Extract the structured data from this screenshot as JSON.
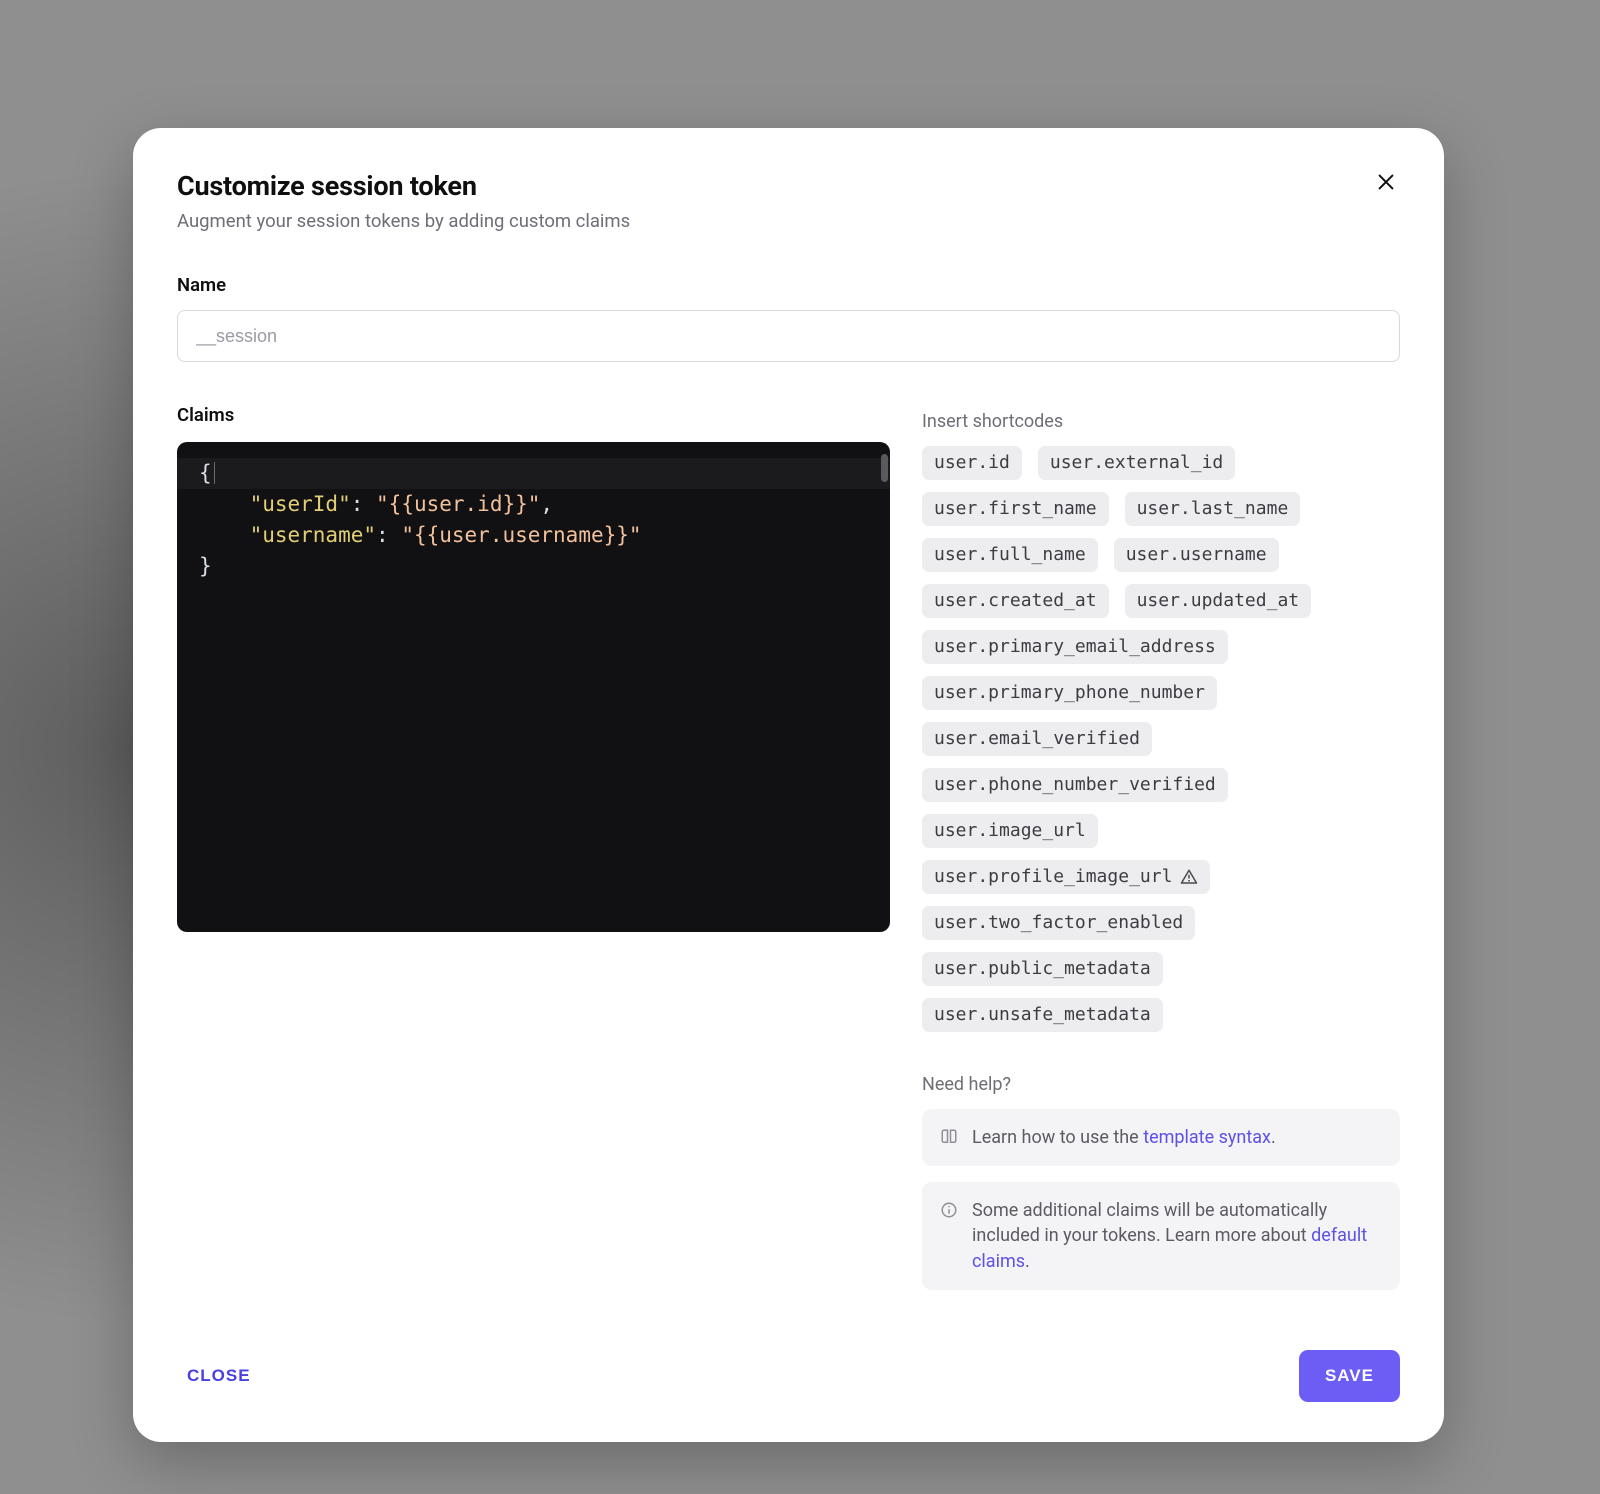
{
  "modal": {
    "title": "Customize session token",
    "subtitle": "Augment your session tokens by adding custom claims",
    "close_icon": "close"
  },
  "name_field": {
    "label": "Name",
    "placeholder": "__session",
    "value": ""
  },
  "claims_field": {
    "label": "Claims",
    "code_tokens": {
      "brace_open": "{",
      "brace_close": "}",
      "line1_key": "\"userId\"",
      "line1_colon": ": ",
      "line1_val": "\"{{user.id}}\"",
      "line1_comma": ",",
      "line2_key": "\"username\"",
      "line2_colon": ": ",
      "line2_val": "\"{{user.username}}\""
    }
  },
  "shortcodes": {
    "label": "Insert shortcodes",
    "items": [
      {
        "text": "user.id",
        "warn": false
      },
      {
        "text": "user.external_id",
        "warn": false
      },
      {
        "text": "user.first_name",
        "warn": false
      },
      {
        "text": "user.last_name",
        "warn": false
      },
      {
        "text": "user.full_name",
        "warn": false
      },
      {
        "text": "user.username",
        "warn": false
      },
      {
        "text": "user.created_at",
        "warn": false
      },
      {
        "text": "user.updated_at",
        "warn": false
      },
      {
        "text": "user.primary_email_address",
        "warn": false
      },
      {
        "text": "user.primary_phone_number",
        "warn": false
      },
      {
        "text": "user.email_verified",
        "warn": false
      },
      {
        "text": "user.phone_number_verified",
        "warn": false
      },
      {
        "text": "user.image_url",
        "warn": false
      },
      {
        "text": "user.profile_image_url",
        "warn": true
      },
      {
        "text": "user.two_factor_enabled",
        "warn": false
      },
      {
        "text": "user.public_metadata",
        "warn": false
      },
      {
        "text": "user.unsafe_metadata",
        "warn": false
      }
    ]
  },
  "help": {
    "title": "Need help?",
    "box1_prefix": "Learn how to use the ",
    "box1_link": "template syntax",
    "box1_suffix": ".",
    "box2_prefix": "Some additional claims will be automatically included in your tokens. Learn more about ",
    "box2_link": "default claims",
    "box2_suffix": "."
  },
  "footer": {
    "close_label": "CLOSE",
    "save_label": "SAVE"
  }
}
